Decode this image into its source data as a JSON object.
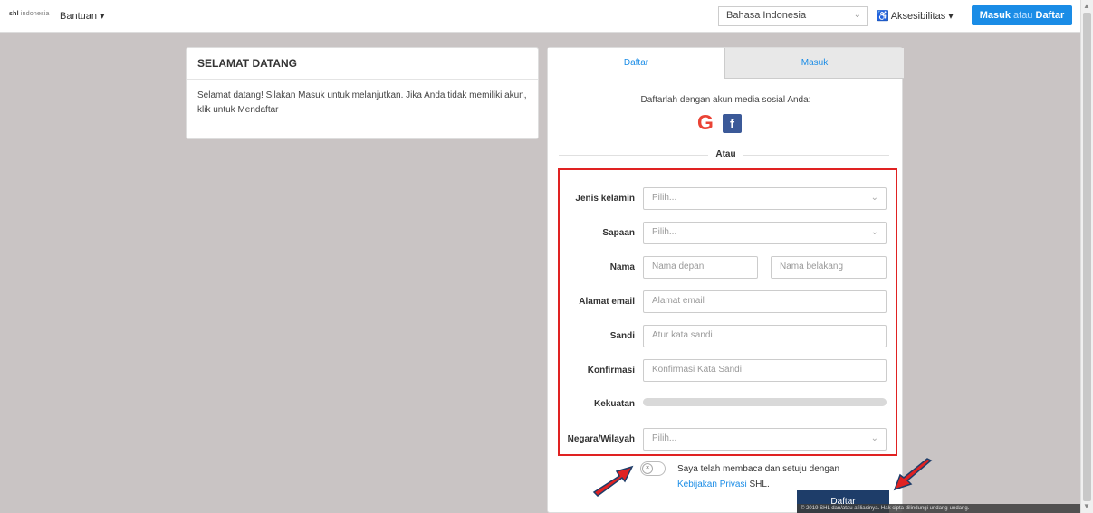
{
  "topbar": {
    "logo_bold": "shl",
    "logo_light": "indonesia",
    "help_label": "Bantuan ▾",
    "language": "Bahasa Indonesia",
    "accessibility_label": "Aksesibilitas ▾",
    "login_label": "Masuk",
    "login_or": "atau",
    "register_label": "Daftar"
  },
  "welcome": {
    "title": "SELAMAT DATANG",
    "text": "Selamat datang! Silakan Masuk untuk melanjutkan. Jika Anda tidak memiliki akun, klik untuk Mendaftar"
  },
  "panel": {
    "tabs": [
      "Daftar",
      "Masuk"
    ],
    "social_text": "Daftarlah dengan akun media sosial Anda:",
    "google_glyph": "G",
    "facebook_glyph": "f",
    "or_text": "Atau"
  },
  "form": {
    "gender_label": "Jenis kelamin",
    "gender_placeholder": "Pilih...",
    "salutation_label": "Sapaan",
    "salutation_placeholder": "Pilih...",
    "name_label": "Nama",
    "first_name_placeholder": "Nama depan",
    "last_name_placeholder": "Nama belakang",
    "email_label": "Alamat email",
    "email_placeholder": "Alamat email",
    "password_label": "Sandi",
    "password_placeholder": "Atur kata sandi",
    "confirm_label": "Konfirmasi",
    "confirm_placeholder": "Konfirmasi Kata Sandi",
    "strength_label": "Kekuatan",
    "country_label": "Negara/Wilayah",
    "country_placeholder": "Pilih..."
  },
  "agreement": {
    "text": "Saya telah membaca dan setuju dengan",
    "link": "Kebijakan Privasi",
    "suffix": "SHL."
  },
  "submit_label": "Daftar",
  "footer_text": "© 2019 SHL dan/atau afiliasinya. Hak cipta dilindungi undang-undang.",
  "colors": {
    "accent": "#1a8ce6",
    "submit": "#1e3d69",
    "highlight": "#e02222"
  }
}
